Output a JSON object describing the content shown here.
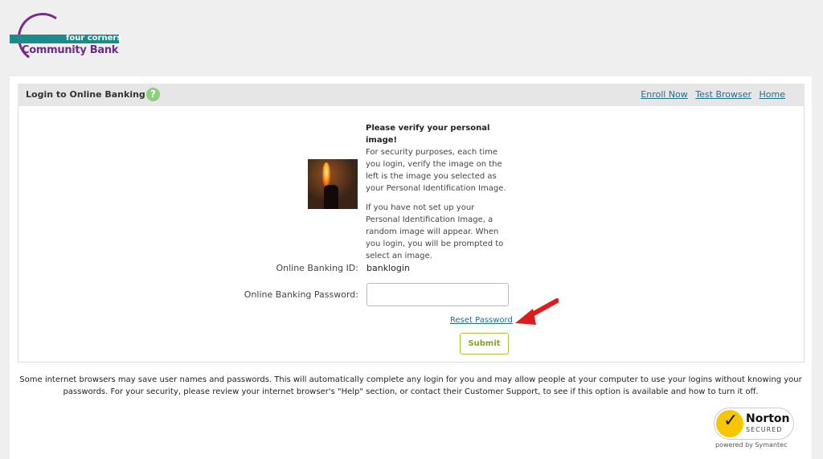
{
  "logo": {
    "line1": "four corners",
    "line2": "Community Bank"
  },
  "header": {
    "title": "Login to Online Banking",
    "help_glyph": "?",
    "links": [
      "Enroll Now",
      "Test Browser",
      "Home"
    ]
  },
  "verify": {
    "heading": "Please verify your personal image!",
    "para1": "For security purposes, each time you login, verify the image on the left is the image you selected as your Personal Identification Image.",
    "para2": "If you have not set up your Personal Identification Image, a random image will appear. When you login, you will be prompted to select an image."
  },
  "form": {
    "id_label": "Online Banking ID:",
    "id_value": "banklogin",
    "password_label": "Online Banking Password:",
    "password_value": "",
    "reset_label": "Reset Password",
    "submit_label": "Submit"
  },
  "notice": "Some internet browsers may save user names and passwords. This will automatically complete any login for you and may allow people at your computer to use your logins without knowing your passwords. For your security, please review your internet browser's \"Help\" section, or contact their Customer Support, to see if this option is available and how to turn it off.",
  "norton": {
    "name": "Norton",
    "secured": "SECURED",
    "powered": "powered by Symantec"
  },
  "colors": {
    "accent_link": "#1f6f8b",
    "brand_purple": "#6e2a8a",
    "brand_teal": "#1a8a8a",
    "submit": "#8aa020",
    "arrow": "#e01b1b"
  },
  "icons": [
    "help-icon",
    "norton-check-icon",
    "red-arrow-icon"
  ]
}
